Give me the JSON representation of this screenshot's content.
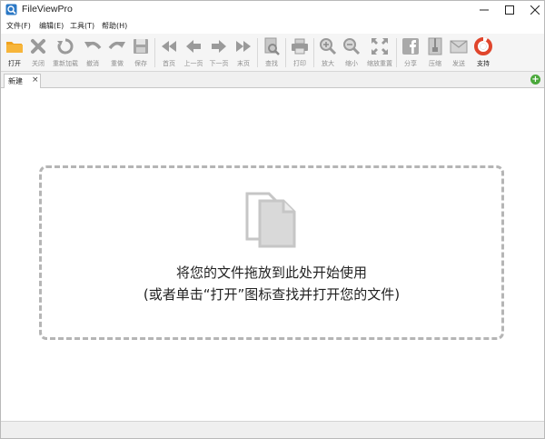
{
  "window": {
    "title": "FileViewPro"
  },
  "menu": {
    "items": [
      {
        "label": "文件(F)"
      },
      {
        "label": "编辑(E)"
      },
      {
        "label": "工具(T)"
      },
      {
        "label": "帮助(H)"
      }
    ]
  },
  "toolbar": {
    "tools": [
      {
        "label": "打开",
        "icon": "folder-open-icon",
        "enabled": true
      },
      {
        "label": "关闭",
        "icon": "close-x-icon",
        "enabled": false
      },
      {
        "label": "重新加载",
        "icon": "reload-icon",
        "enabled": false
      },
      {
        "label": "撤消",
        "icon": "undo-icon",
        "enabled": false
      },
      {
        "label": "重做",
        "icon": "redo-icon",
        "enabled": false
      },
      {
        "label": "保存",
        "icon": "save-disk-icon",
        "enabled": false
      },
      {
        "label": "首页",
        "icon": "first-page-icon",
        "enabled": false
      },
      {
        "label": "上一页",
        "icon": "previous-page-icon",
        "enabled": false
      },
      {
        "label": "下一页",
        "icon": "next-page-icon",
        "enabled": false
      },
      {
        "label": "末页",
        "icon": "last-page-icon",
        "enabled": false
      },
      {
        "label": "查找",
        "icon": "find-icon",
        "enabled": false
      },
      {
        "label": "打印",
        "icon": "printer-icon",
        "enabled": false
      },
      {
        "label": "放大",
        "icon": "zoom-in-icon",
        "enabled": false
      },
      {
        "label": "缩小",
        "icon": "zoom-out-icon",
        "enabled": false
      },
      {
        "label": "缩放重置",
        "icon": "zoom-reset-icon",
        "enabled": false
      },
      {
        "label": "分享",
        "icon": "facebook-share-icon",
        "enabled": false
      },
      {
        "label": "压缩",
        "icon": "zip-icon",
        "enabled": false
      },
      {
        "label": "发送",
        "icon": "email-icon",
        "enabled": false
      },
      {
        "label": "支持",
        "icon": "support-lifebuoy-icon",
        "enabled": true
      }
    ]
  },
  "tabs": {
    "items": [
      {
        "label": "新建",
        "close": "×"
      }
    ],
    "add_label": "+"
  },
  "dropzone": {
    "line1": "将您的文件拖放到此处开始使用",
    "line2": "(或者单击“打开”图标查找并打开您的文件)"
  },
  "colors": {
    "accent_orange": "#f5a623",
    "support_red": "#e0452c",
    "disabled_gray": "#9a9a9a",
    "add_green": "#4aa83b"
  }
}
